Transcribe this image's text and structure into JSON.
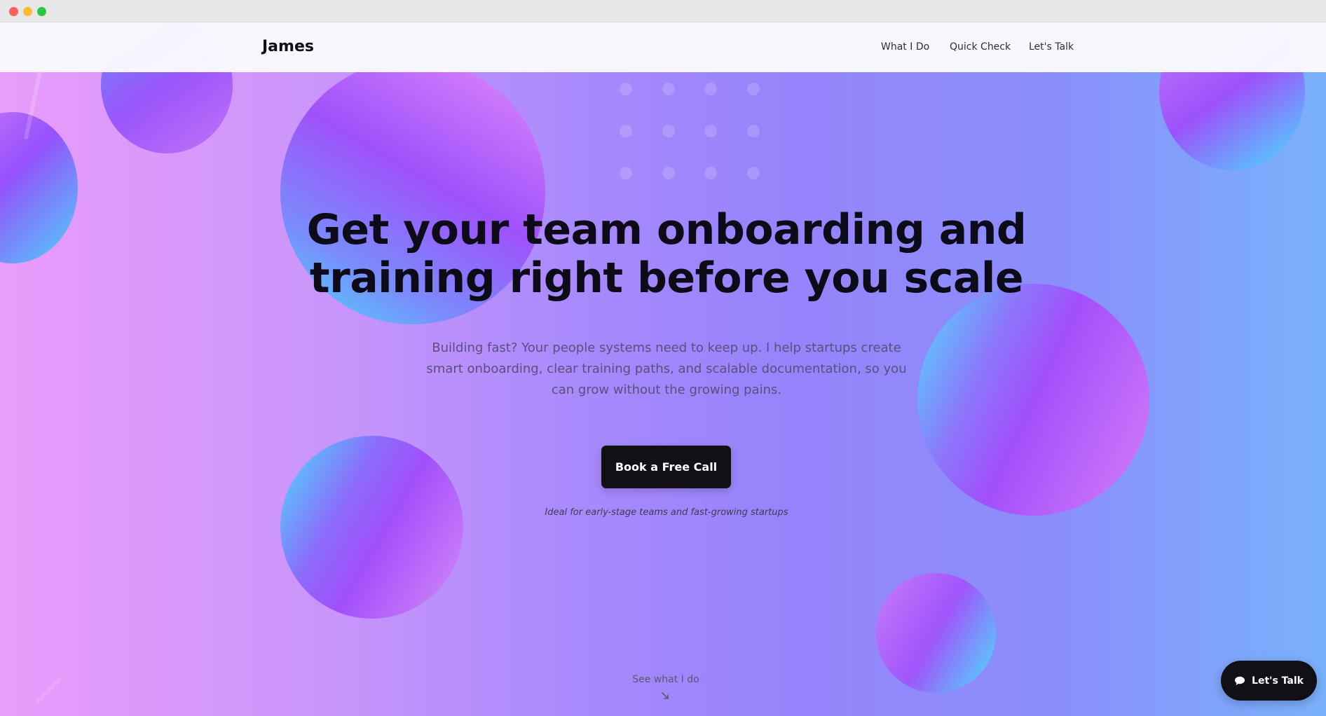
{
  "window": {
    "controls": [
      "close",
      "minimize",
      "maximize"
    ]
  },
  "nav": {
    "brand": "James",
    "links": [
      {
        "label": "What I Do"
      },
      {
        "label": "Quick Check"
      },
      {
        "label": "Let's Talk"
      }
    ]
  },
  "hero": {
    "headline_line1": "Get your team onboarding and",
    "headline_line2": "training right before you scale",
    "subtitle_line1": "Building fast? Your people systems need to keep up. I help startups create",
    "subtitle_line2": "smart onboarding, clear training paths, and scalable documentation, so you",
    "subtitle_line3": "can grow without the growing pains.",
    "cta_label": "Book a Free Call",
    "note": "Ideal for early-stage teams and fast-growing startups",
    "scroll_label": "See what I do",
    "scroll_icon": "arrow-down-icon"
  },
  "chat_widget": {
    "label": "Let's Talk",
    "icon": "chat-bubble-icon"
  },
  "colors": {
    "cta_bg": "#111016",
    "headline": "#0d0b17",
    "bg_left": "#e99cfb",
    "bg_right": "#79b1fb"
  }
}
